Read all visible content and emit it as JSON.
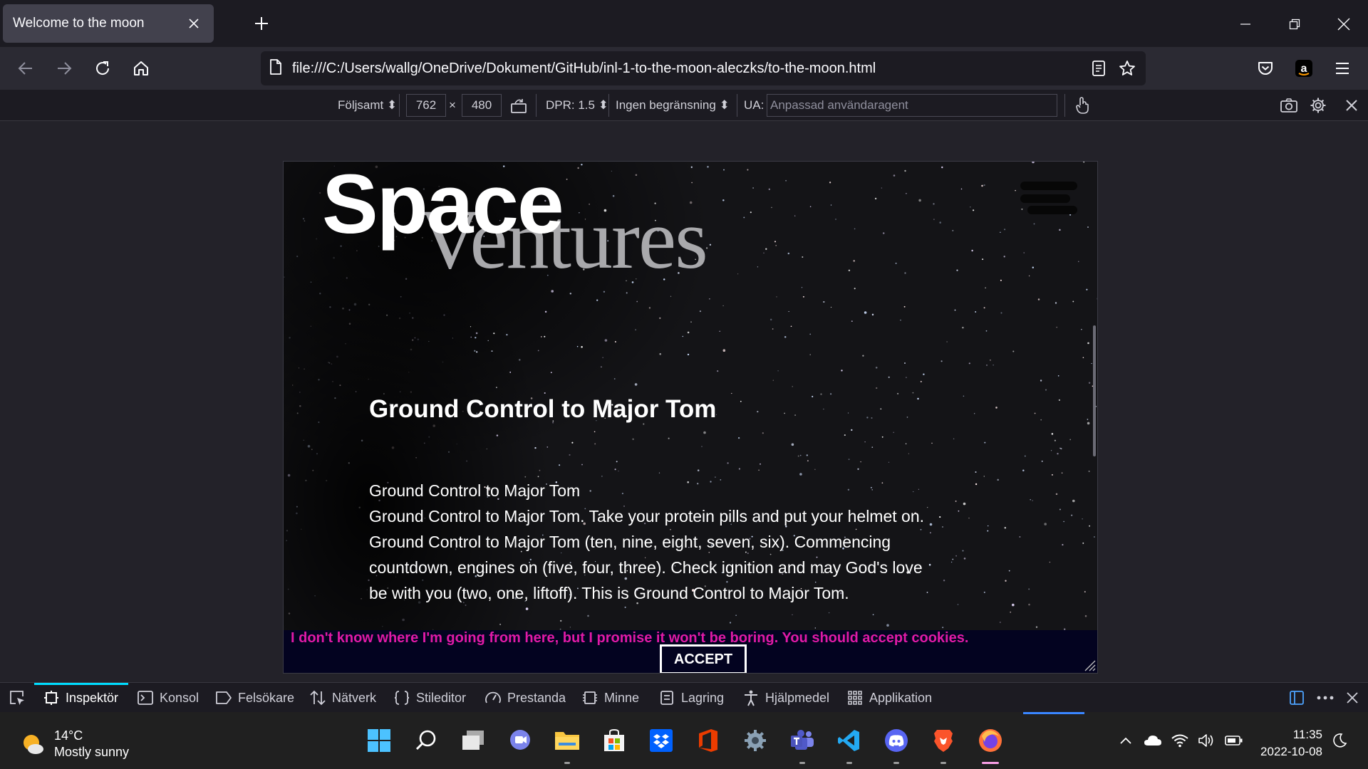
{
  "browser": {
    "tab_title": "Welcome to the moon",
    "url": "file:///C:/Users/wallg/OneDrive/Dokument/GitHub/inl-1-to-the-moon-aleczks/to-the-moon.html"
  },
  "rdm_toolbar": {
    "device": "Följsamt ⬍",
    "width": "762",
    "times": "×",
    "height": "480",
    "dpr": "DPR: 1.5 ⬍",
    "throttling": "Ingen begränsning ⬍",
    "ua_label": "UA:",
    "ua_placeholder": "Anpassad användaragent"
  },
  "page": {
    "logo_space": "Space",
    "logo_ventures": "Ventures",
    "heading": "Ground Control to Major Tom",
    "body_line1": "Ground Control to Major Tom",
    "body_text": "Ground Control to Major Tom. Take your protein pills and put your helmet on. Ground Control to Major Tom (ten, nine, eight, seven, six). Commencing countdown, engines on (five, four, three). Check ignition and may God's love be with you (two, one, liftoff). This is Ground Control to Major Tom.",
    "cookie_text": "I don't know where I'm going from here, but I promise it won't be boring. You should accept cookies.",
    "accept_label": "ACCEPT",
    "colors": {
      "cookie_text": "#e01aa7",
      "cookie_bg": "#030320"
    }
  },
  "devtools": {
    "tabs": [
      "Inspektör",
      "Konsol",
      "Felsökare",
      "Nätverk",
      "Stileditor",
      "Prestanda",
      "Minne",
      "Lagring",
      "Hjälpmedel",
      "Applikation"
    ]
  },
  "taskbar": {
    "temperature": "14°C",
    "weather": "Mostly sunny",
    "time": "11:35",
    "date": "2022-10-08"
  }
}
